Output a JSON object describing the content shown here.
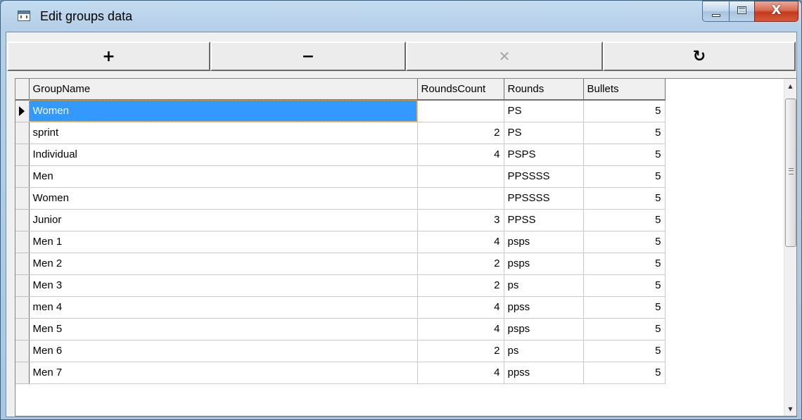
{
  "window": {
    "title": "Edit groups data",
    "close_glyph": "X"
  },
  "toolbar": {
    "buttons": [
      {
        "symbol": "+",
        "icon": "plus-icon",
        "enabled": true
      },
      {
        "symbol": "−",
        "icon": "minus-icon",
        "enabled": true
      },
      {
        "symbol": "✕",
        "icon": "cancel-icon",
        "enabled": false
      },
      {
        "symbol": "↻",
        "icon": "refresh-icon",
        "enabled": true
      }
    ]
  },
  "grid": {
    "columns": [
      "GroupName",
      "RoundsCount",
      "Rounds",
      "Bullets"
    ],
    "selected_row": 0,
    "rows": [
      {
        "name": "Women",
        "count": "",
        "rounds": "PS",
        "bullets": "5"
      },
      {
        "name": "sprint",
        "count": "2",
        "rounds": "PS",
        "bullets": "5"
      },
      {
        "name": "Individual",
        "count": "4",
        "rounds": "PSPS",
        "bullets": "5"
      },
      {
        "name": "Men",
        "count": "",
        "rounds": "PPSSSS",
        "bullets": "5"
      },
      {
        "name": "Women",
        "count": "",
        "rounds": "PPSSSS",
        "bullets": "5"
      },
      {
        "name": "Junior",
        "count": "3",
        "rounds": "PPSS",
        "bullets": "5"
      },
      {
        "name": "Men 1",
        "count": "4",
        "rounds": "psps",
        "bullets": "5"
      },
      {
        "name": "Men 2",
        "count": "2",
        "rounds": "psps",
        "bullets": "5"
      },
      {
        "name": "Men 3",
        "count": "2",
        "rounds": "ps",
        "bullets": "5"
      },
      {
        "name": "men 4",
        "count": "4",
        "rounds": "ppss",
        "bullets": "5"
      },
      {
        "name": "Men 5",
        "count": "4",
        "rounds": "psps",
        "bullets": "5"
      },
      {
        "name": "Men 6",
        "count": "2",
        "rounds": "ps",
        "bullets": "5"
      },
      {
        "name": "Men 7",
        "count": "4",
        "rounds": "ppss",
        "bullets": "5"
      }
    ]
  },
  "colors": {
    "selection": "#3399ff",
    "close_button": "#c6391b"
  }
}
